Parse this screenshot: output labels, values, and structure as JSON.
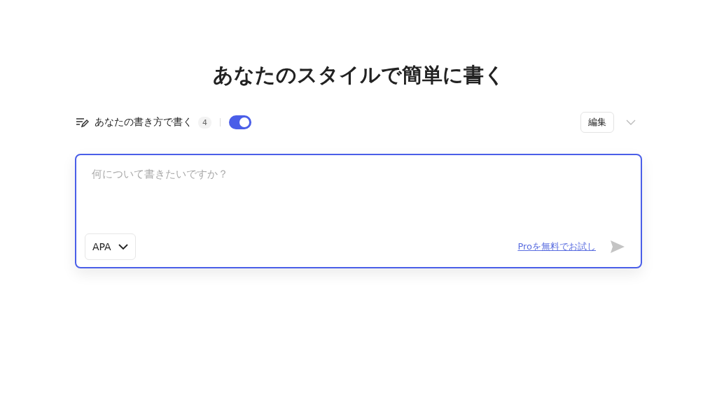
{
  "title": "あなたのスタイルで簡単に書く",
  "style_bar": {
    "label": "あなたの書き方で書く",
    "count": "4",
    "toggle": {
      "on": true
    },
    "edit_button": "編集",
    "expanded": false
  },
  "composer": {
    "placeholder": "何について書きたいですか？",
    "citation_style": "APA",
    "promo_link": "Proを無料でお試し",
    "send_disabled": true
  }
}
